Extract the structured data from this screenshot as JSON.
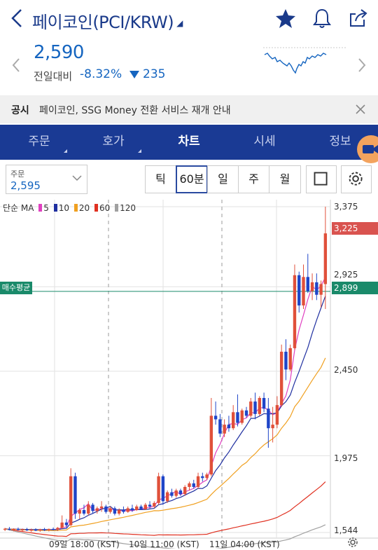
{
  "header": {
    "title": "페이코인(PCI/KRW)",
    "back_icon": "chevron-left-icon",
    "caret_icon": "caret-down-icon",
    "icons": [
      "star-icon",
      "bell-icon",
      "share-icon"
    ],
    "accent": "#1a3a8a"
  },
  "quote": {
    "price": "2,590",
    "change_label": "전일대비",
    "change_pct": "-8.32%",
    "change_amt": "235",
    "down_color": "#1565c0"
  },
  "notice": {
    "label": "공시",
    "text": "페이코인, SSG Money 전환 서비스 재개 안내"
  },
  "tabs": [
    {
      "label": "주문",
      "has_caret": true
    },
    {
      "label": "호가",
      "has_caret": true
    },
    {
      "label": "차트",
      "active": true
    },
    {
      "label": "시세"
    },
    {
      "label": "정보"
    }
  ],
  "toolbar": {
    "order_label": "주문",
    "order_price": "2,595",
    "periods": [
      "틱",
      "60분",
      "일",
      "주",
      "월"
    ],
    "selected_period": "60분"
  },
  "chart": {
    "ma_label": "단순 MA",
    "ma_periods": [
      "5",
      "10",
      "20",
      "60",
      "120"
    ],
    "ma_colors": [
      "#e040c0",
      "#1f2fa0",
      "#f0a020",
      "#e03020",
      "#a0a0a0"
    ],
    "y_labels": [
      "3,375",
      "2,925",
      "2,450",
      "1,975",
      "1,544"
    ],
    "current_price_badge": "3,225",
    "avg_price_badge": "2,899",
    "avg_price_label": "매수평균",
    "x_labels": [
      "09일 18:00 (KST)",
      "10일 11:00 (KST)",
      "11일 04:00 (KST)"
    ],
    "up_color": "#e0503a",
    "down_color": "#1f45c8"
  },
  "chart_data": {
    "type": "candlestick",
    "x_labels": [
      "09일 18:00 (KST)",
      "10일 11:00 (KST)",
      "11일 04:00 (KST)"
    ],
    "y_ticks": [
      1544,
      1975,
      2450,
      2925,
      3375
    ],
    "current_price": 3225,
    "average_price": 2899,
    "candles": [
      [
        1560,
        1570,
        1552,
        1565
      ],
      [
        1565,
        1575,
        1556,
        1560
      ],
      [
        1560,
        1568,
        1550,
        1564
      ],
      [
        1564,
        1572,
        1555,
        1558
      ],
      [
        1558,
        1566,
        1550,
        1562
      ],
      [
        1562,
        1570,
        1552,
        1556
      ],
      [
        1556,
        1566,
        1548,
        1560
      ],
      [
        1560,
        1568,
        1552,
        1555
      ],
      [
        1555,
        1565,
        1548,
        1562
      ],
      [
        1562,
        1570,
        1552,
        1558
      ],
      [
        1558,
        1566,
        1550,
        1564
      ],
      [
        1564,
        1572,
        1556,
        1560
      ],
      [
        1560,
        1575,
        1552,
        1570
      ],
      [
        1570,
        1640,
        1565,
        1600
      ],
      [
        1600,
        1620,
        1572,
        1585
      ],
      [
        1585,
        1905,
        1580,
        1860
      ],
      [
        1860,
        1880,
        1620,
        1650
      ],
      [
        1650,
        1680,
        1620,
        1670
      ],
      [
        1670,
        1700,
        1640,
        1650
      ],
      [
        1650,
        1720,
        1640,
        1700
      ],
      [
        1700,
        1710,
        1650,
        1665
      ],
      [
        1665,
        1690,
        1650,
        1680
      ],
      [
        1680,
        1720,
        1660,
        1690
      ],
      [
        1690,
        1700,
        1650,
        1660
      ],
      [
        1660,
        1690,
        1650,
        1680
      ],
      [
        1680,
        1690,
        1640,
        1650
      ],
      [
        1650,
        1680,
        1640,
        1670
      ],
      [
        1670,
        1690,
        1650,
        1660
      ],
      [
        1660,
        1690,
        1655,
        1680
      ],
      [
        1680,
        1700,
        1660,
        1670
      ],
      [
        1670,
        1700,
        1665,
        1690
      ],
      [
        1690,
        1700,
        1670,
        1675
      ],
      [
        1675,
        1710,
        1670,
        1700
      ],
      [
        1700,
        1720,
        1680,
        1690
      ],
      [
        1690,
        1720,
        1680,
        1710
      ],
      [
        1710,
        1880,
        1700,
        1860
      ],
      [
        1860,
        1870,
        1700,
        1720
      ],
      [
        1720,
        1780,
        1710,
        1770
      ],
      [
        1770,
        1790,
        1740,
        1750
      ],
      [
        1750,
        1790,
        1740,
        1780
      ],
      [
        1780,
        1790,
        1750,
        1760
      ],
      [
        1760,
        1810,
        1750,
        1800
      ],
      [
        1800,
        1830,
        1780,
        1820
      ],
      [
        1820,
        1840,
        1790,
        1800
      ],
      [
        1800,
        1880,
        1790,
        1860
      ],
      [
        1860,
        1880,
        1830,
        1850
      ],
      [
        1850,
        1880,
        1840,
        1870
      ],
      [
        1870,
        2300,
        1860,
        2200
      ],
      [
        2200,
        2280,
        2150,
        2180
      ],
      [
        2180,
        2210,
        2080,
        2100
      ],
      [
        2100,
        2180,
        2080,
        2150
      ],
      [
        2150,
        2200,
        2110,
        2130
      ],
      [
        2130,
        2260,
        2120,
        2220
      ],
      [
        2220,
        2320,
        2140,
        2160
      ],
      [
        2160,
        2240,
        2150,
        2230
      ],
      [
        2230,
        2250,
        2190,
        2200
      ],
      [
        2200,
        2300,
        2190,
        2280
      ],
      [
        2280,
        2330,
        2180,
        2210
      ],
      [
        2210,
        2310,
        2200,
        2300
      ],
      [
        2300,
        2330,
        2220,
        2240
      ],
      [
        2240,
        2300,
        2020,
        2130
      ],
      [
        2130,
        2250,
        2050,
        2150
      ],
      [
        2150,
        2310,
        2130,
        2260
      ],
      [
        2260,
        2600,
        2250,
        2560
      ],
      [
        2560,
        2630,
        2400,
        2460
      ],
      [
        2460,
        2600,
        2450,
        2580
      ],
      [
        2580,
        3050,
        2570,
        2990
      ],
      [
        2990,
        3010,
        2780,
        2820
      ],
      [
        2820,
        3050,
        2800,
        2980
      ],
      [
        2980,
        3110,
        2890,
        2900
      ],
      [
        2900,
        3000,
        2850,
        2950
      ],
      [
        2950,
        3000,
        2850,
        2880
      ],
      [
        2880,
        2960,
        2810,
        2940
      ],
      [
        2940,
        3375,
        2800,
        3225
      ]
    ]
  }
}
